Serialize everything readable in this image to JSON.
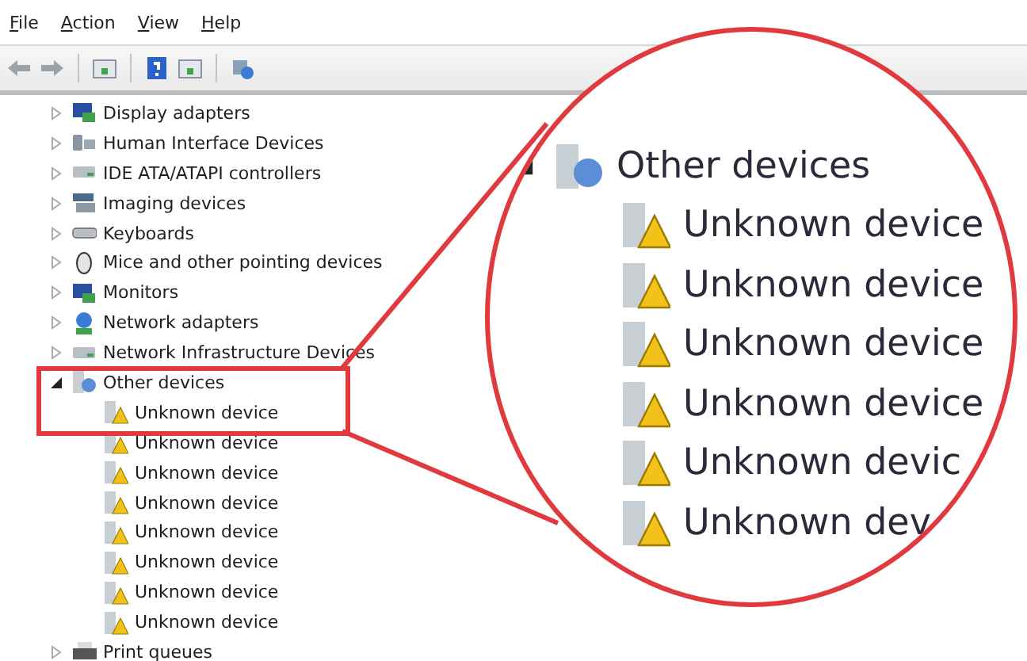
{
  "menu": [
    "File",
    "Action",
    "View",
    "Help"
  ],
  "tree": [
    {
      "label": "Display adapters",
      "expanded": false
    },
    {
      "label": "Human Interface Devices",
      "expanded": false
    },
    {
      "label": "IDE ATA/ATAPI controllers",
      "expanded": false
    },
    {
      "label": "Imaging devices",
      "expanded": false
    },
    {
      "label": "Keyboards",
      "expanded": false
    },
    {
      "label": "Mice and other pointing devices",
      "expanded": false
    },
    {
      "label": "Monitors",
      "expanded": false
    },
    {
      "label": "Network adapters",
      "expanded": false
    },
    {
      "label": "Network Infrastructure Devices",
      "expanded": false
    },
    {
      "label": "Other devices",
      "expanded": true,
      "children": [
        {
          "label": "Unknown device"
        },
        {
          "label": "Unknown device"
        },
        {
          "label": "Unknown device"
        },
        {
          "label": "Unknown device"
        },
        {
          "label": "Unknown device"
        },
        {
          "label": "Unknown device"
        },
        {
          "label": "Unknown device"
        },
        {
          "label": "Unknown device"
        }
      ]
    },
    {
      "label": "Print queues",
      "expanded": false
    }
  ],
  "magnifier": {
    "label": "Other devices",
    "expanded": true,
    "items": [
      "Unknown device",
      "Unknown device",
      "Unknown device",
      "Unknown device",
      "Unknown devic",
      "Unknown dev"
    ]
  }
}
